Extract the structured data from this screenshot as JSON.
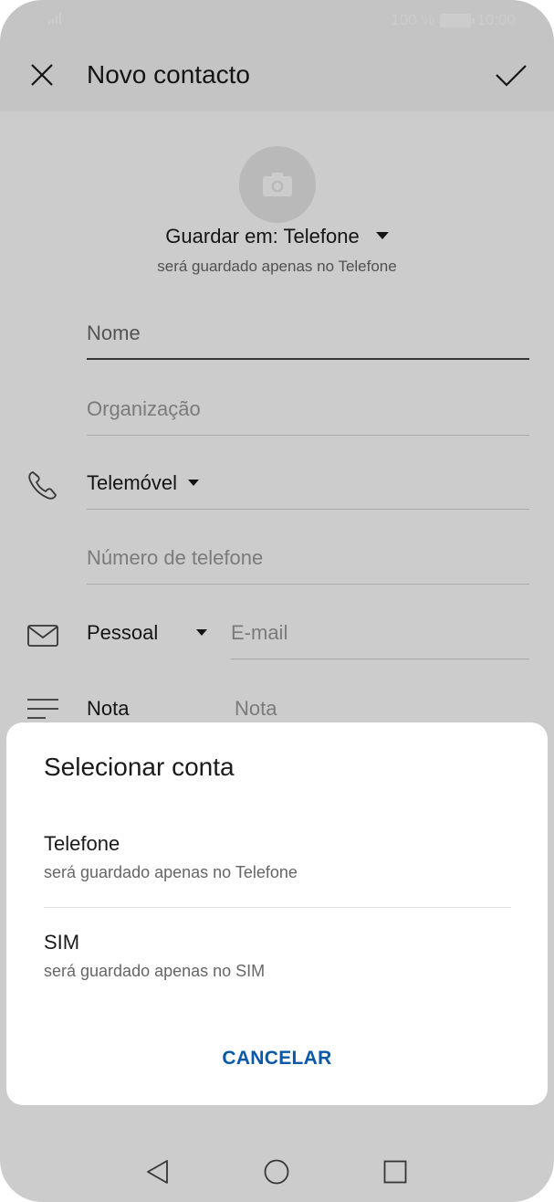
{
  "status": {
    "battery_text": "100 %",
    "time": "10:00"
  },
  "appbar": {
    "title": "Novo contacto"
  },
  "form": {
    "save_in": "Guardar em: Telefone",
    "save_sub": "será guardado apenas no Telefone",
    "name_placeholder": "Nome",
    "org_placeholder": "Organização",
    "phone_type": "Telemóvel",
    "phone_placeholder": "Número de telefone",
    "email_type": "Pessoal",
    "email_placeholder": "E-mail",
    "note_label": "Nota",
    "note_placeholder": "Nota"
  },
  "sheet": {
    "title": "Selecionar conta",
    "options": [
      {
        "title": "Telefone",
        "subtitle": "será guardado apenas no Telefone"
      },
      {
        "title": "SIM",
        "subtitle": "será guardado apenas no SIM"
      }
    ],
    "cancel": "CANCELAR"
  },
  "colors": {
    "accent": "#0a59a8",
    "dim": "rgba(0,0,0,0.20)"
  }
}
